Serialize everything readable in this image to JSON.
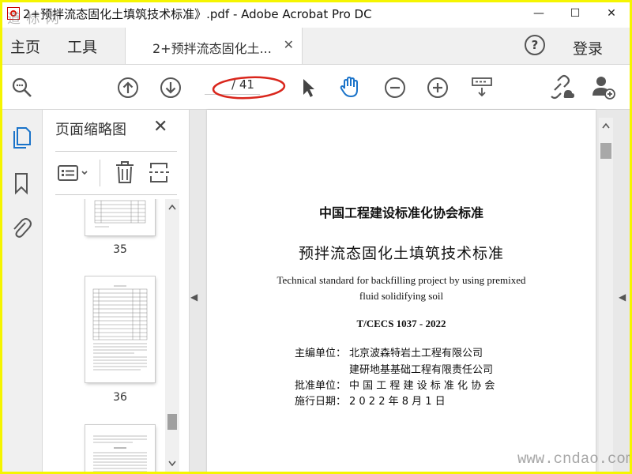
{
  "window": {
    "title": "2+预拌流态固化土填筑技术标准》.pdf - Adobe Acrobat Pro DC",
    "watermark_top": "道 标 网",
    "controls": {
      "minimize": "—",
      "maximize": "☐",
      "close": "✕"
    }
  },
  "tabs": {
    "home": "主页",
    "tools": "工具",
    "document": "2+预拌流态固化土...",
    "close": "✕",
    "login": "登录",
    "help": "?"
  },
  "toolbar": {
    "page_total": "/ 41",
    "icons": [
      "zoom-search-icon",
      "page-up-icon",
      "page-down-icon",
      "select-cursor-icon",
      "hand-tool-icon",
      "zoom-out-icon",
      "zoom-in-icon",
      "scroll-mode-icon",
      "share-link-icon",
      "add-user-icon"
    ],
    "annotation_color": "#d9261c"
  },
  "panel": {
    "title": "页面缩略图",
    "close": "✕",
    "thumbnails": [
      {
        "label": "35"
      },
      {
        "label": "36"
      }
    ]
  },
  "page": {
    "org": "中国工程建设标准化协会标准",
    "title": "预拌流态固化土填筑技术标准",
    "english_line1": "Technical standard for backfilling project by using premixed",
    "english_line2": "fluid solidifying soil",
    "code": "T/CECS 1037 - 2022",
    "chief_label": "主编单位：",
    "chief_1": "北京波森特岩土工程有限公司",
    "chief_2": "建研地基基础工程有限责任公司",
    "approve_label": "批准单位：",
    "approve": "中 国 工 程 建 设 标 准 化 协 会",
    "date_label": "施行日期：",
    "date": "2 0 2 2  年  8  月  1  日"
  },
  "watermark_bottom": "www.cndao.com",
  "accent": "#1a73c9"
}
